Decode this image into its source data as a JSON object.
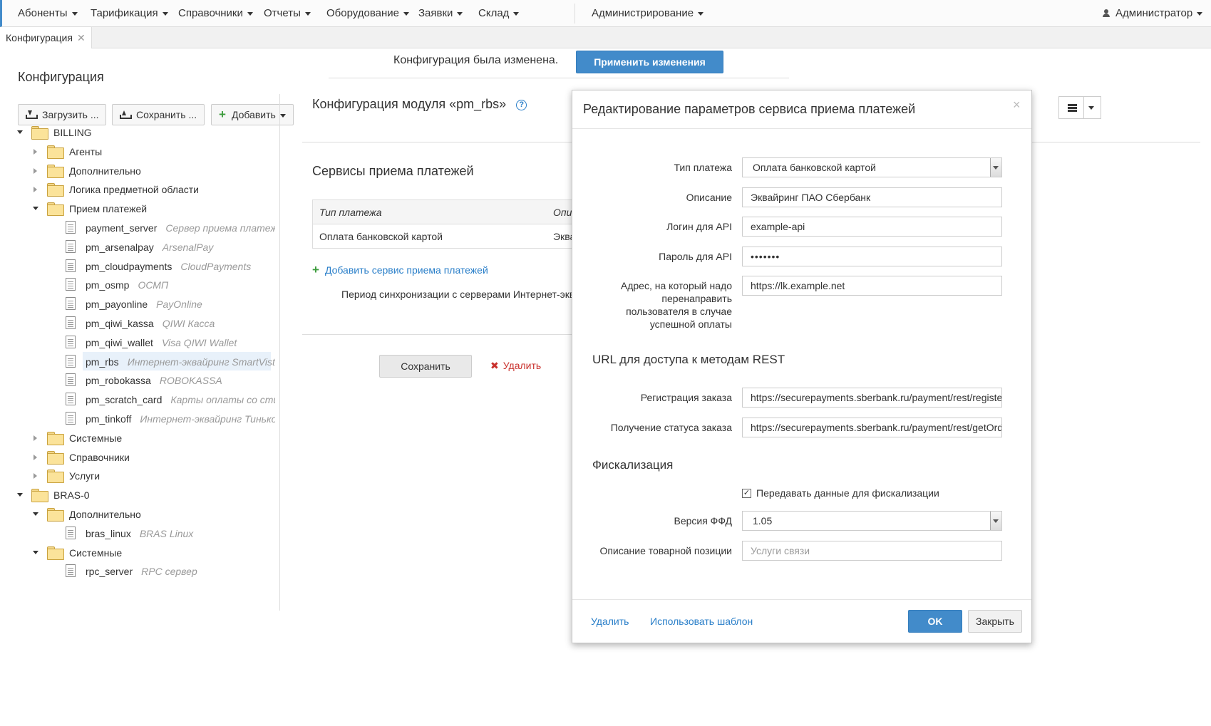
{
  "nav": {
    "items": [
      "Абоненты",
      "Тарификация",
      "Справочники",
      "Отчеты",
      "Оборудование",
      "Заявки",
      "Склад",
      "Администрирование"
    ],
    "user": "Администратор"
  },
  "tabs": [
    {
      "label": "Конфигурация",
      "close": "✕"
    }
  ],
  "page": {
    "title": "Конфигурация",
    "toolbar": {
      "load": "Загрузить ...",
      "save": "Сохранить ...",
      "add": "Добавить"
    }
  },
  "notification": {
    "text": "Конфигурация была изменена.",
    "apply": "Применить изменения"
  },
  "tree": [
    {
      "label": "BILLING",
      "kind": "folder",
      "level": 0,
      "state": "open"
    },
    {
      "label": "Агенты",
      "kind": "folder",
      "level": 1,
      "state": "closed"
    },
    {
      "label": "Дополнительно",
      "kind": "folder",
      "level": 1,
      "state": "closed"
    },
    {
      "label": "Логика предметной области",
      "kind": "folder",
      "level": 1,
      "state": "closed"
    },
    {
      "label": "Прием платежей",
      "kind": "folder",
      "level": 1,
      "state": "open"
    },
    {
      "label": "payment_server",
      "desc": "Сервер приема платежей",
      "kind": "doc",
      "level": 2
    },
    {
      "label": "pm_arsenalpay",
      "desc": "ArsenalPay",
      "kind": "doc",
      "level": 2
    },
    {
      "label": "pm_cloudpayments",
      "desc": "CloudPayments",
      "kind": "doc",
      "level": 2
    },
    {
      "label": "pm_osmp",
      "desc": "ОСМП",
      "kind": "doc",
      "level": 2
    },
    {
      "label": "pm_payonline",
      "desc": "PayOnline",
      "kind": "doc",
      "level": 2
    },
    {
      "label": "pm_qiwi_kassa",
      "desc": "QIWI Касса",
      "kind": "doc",
      "level": 2
    },
    {
      "label": "pm_qiwi_wallet",
      "desc": "Visa QIWI Wallet",
      "kind": "doc",
      "level": 2
    },
    {
      "label": "pm_rbs",
      "desc": "Интернет-эквайринг SmartVista",
      "kind": "doc",
      "level": 2,
      "selected": true
    },
    {
      "label": "pm_robokassa",
      "desc": "ROBOKASSA",
      "kind": "doc",
      "level": 2
    },
    {
      "label": "pm_scratch_card",
      "desc": "Карты оплаты со стира",
      "kind": "doc",
      "level": 2
    },
    {
      "label": "pm_tinkoff",
      "desc": "Интернет-эквайринг Тинькоф",
      "kind": "doc",
      "level": 2
    },
    {
      "label": "Системные",
      "kind": "folder",
      "level": 1,
      "state": "closed"
    },
    {
      "label": "Справочники",
      "kind": "folder",
      "level": 1,
      "state": "closed"
    },
    {
      "label": "Услуги",
      "kind": "folder",
      "level": 1,
      "state": "closed"
    },
    {
      "label": "BRAS-0",
      "kind": "folder",
      "level": 0,
      "state": "open"
    },
    {
      "label": "Дополнительно",
      "kind": "folder",
      "level": 1,
      "state": "open"
    },
    {
      "label": "bras_linux",
      "desc": "BRAS Linux",
      "kind": "doc",
      "level": 2
    },
    {
      "label": "Системные",
      "kind": "folder",
      "level": 1,
      "state": "open"
    },
    {
      "label": "rpc_server",
      "desc": "RPC сервер",
      "kind": "doc",
      "level": 2
    }
  ],
  "module": {
    "title": "Конфигурация модуля «pm_rbs»",
    "help": "?",
    "services_title": "Сервисы приема платежей",
    "grid": {
      "columns": [
        "Тип платежа",
        "Опис"
      ],
      "rows": [
        [
          "Оплата банковской картой",
          "Эква"
        ]
      ]
    },
    "add_link": "Добавить сервис приема платежей",
    "sync_text": "Период синхронизации с серверами Интернет-эквайринга",
    "save": "Сохранить",
    "delete": "Удалить"
  },
  "modal": {
    "title": "Редактирование параметров сервиса приема платежей",
    "close": "×",
    "fields": {
      "payment_type": {
        "label": "Тип платежа",
        "value": "Оплата банковской картой"
      },
      "description": {
        "label": "Описание",
        "value": "Эквайринг ПАО Сбербанк"
      },
      "api_login": {
        "label": "Логин для API",
        "value": "example-api"
      },
      "api_password": {
        "label": "Пароль для API",
        "value": "•••••••"
      },
      "redirect_url": {
        "label_lines": [
          "Адрес, на который надо",
          "перенаправить",
          "пользователя в случае",
          "успешной оплаты"
        ],
        "value": "https://lk.example.net"
      }
    },
    "rest": {
      "title": "URL для доступа к методам REST",
      "register": {
        "label": "Регистрация заказа",
        "value": "https://securepayments.sberbank.ru/payment/rest/register.do"
      },
      "status": {
        "label": "Получение статуса заказа",
        "value": "https://securepayments.sberbank.ru/payment/rest/getOrderStatusExtended.do"
      }
    },
    "fiscal": {
      "title": "Фискализация",
      "send": {
        "label": "Передавать данные для фискализации",
        "checked": true,
        "mark": "✓"
      },
      "ffd": {
        "label": "Версия ФФД",
        "value": "1.05"
      },
      "item_desc": {
        "label": "Описание товарной позиции",
        "placeholder": "Услуги связи"
      }
    },
    "footer": {
      "delete": "Удалить",
      "template": "Использовать шаблон",
      "ok": "OK",
      "close": "Закрыть"
    }
  }
}
